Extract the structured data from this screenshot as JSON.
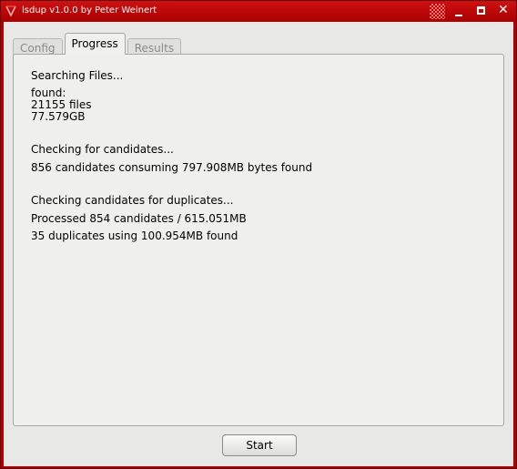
{
  "window": {
    "title": "lsdup v1.0.0 by Peter Weinert",
    "accent_color": "#b00000"
  },
  "tabs": [
    {
      "label": "Config",
      "active": false
    },
    {
      "label": "Progress",
      "active": true
    },
    {
      "label": "Results",
      "active": false
    }
  ],
  "progress": {
    "searching": "Searching Files...",
    "found_label": "found:",
    "files_found": "21155 files",
    "size_found": "77.579GB",
    "checking_candidates": "Checking for candidates...",
    "candidates_result": "856 candidates consuming 797.908MB bytes found",
    "checking_duplicates": "Checking candidates for duplicates...",
    "processed": "Processed 854 candidates / 615.051MB",
    "duplicates_result": "35 duplicates using 100.954MB found"
  },
  "actions": {
    "start_label": "Start"
  },
  "icons": {
    "app": "app-icon",
    "minimize": "minimize-icon",
    "maximize": "maximize-icon",
    "close": "close-icon"
  }
}
